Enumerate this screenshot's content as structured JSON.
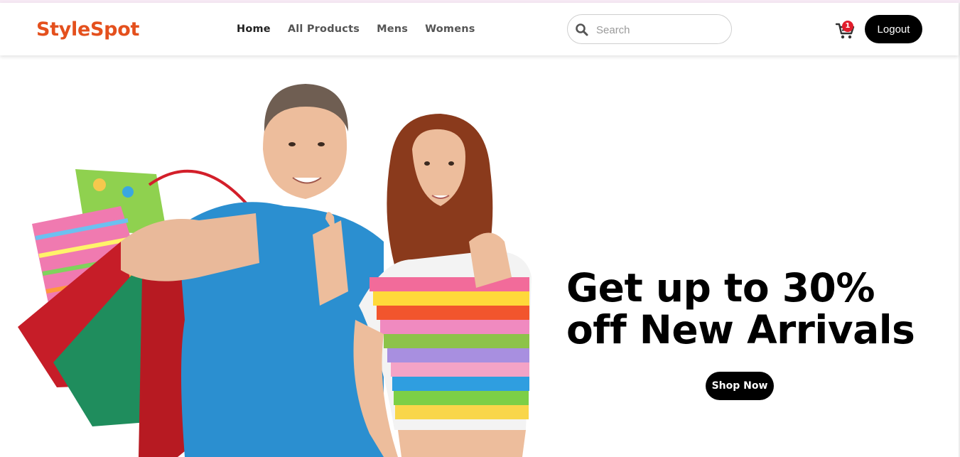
{
  "header": {
    "logo": "StyleSpot",
    "nav": [
      {
        "label": "Home",
        "active": true
      },
      {
        "label": "All Products",
        "active": false
      },
      {
        "label": "Mens",
        "active": false
      },
      {
        "label": "Womens",
        "active": false
      }
    ],
    "search": {
      "placeholder": "Search",
      "value": ""
    },
    "cart": {
      "icon": "cart-icon",
      "count": "1"
    },
    "logout_label": "Logout"
  },
  "hero": {
    "image_alt": "couple-with-shopping-bags",
    "headline_line1": "Get up to 30%",
    "headline_line2": "off New Arrivals",
    "cta_label": "Shop Now"
  },
  "colors": {
    "brand": "#e4501d",
    "button_bg": "#000000",
    "badge": "#e11d2b"
  }
}
